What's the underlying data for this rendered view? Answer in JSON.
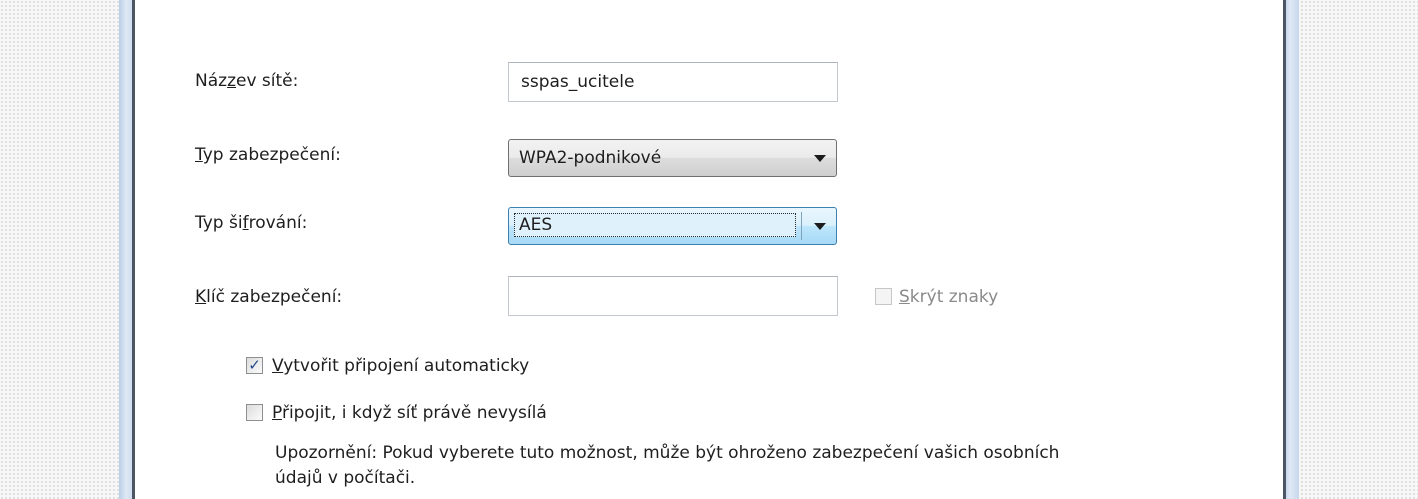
{
  "form": {
    "network_name": {
      "accel": "z",
      "label_before": "Náz",
      "label_after": "ev sítě:",
      "value": "sspas_ucitele"
    },
    "security_type": {
      "accel": "T",
      "label_before": "",
      "label_after": "yp zabezpečení:",
      "selected": "WPA2-podnikové"
    },
    "encryption_type": {
      "accel": "f",
      "label_before": "Typ ši",
      "label_after": "rování:",
      "selected": "AES"
    },
    "security_key": {
      "accel": "K",
      "label_before": "",
      "label_after": "líč zabezpečení:",
      "value": ""
    },
    "hide_characters": {
      "accel": "S",
      "label_before": "",
      "label_after": "krýt znaky",
      "checked": false,
      "enabled": false
    },
    "auto_connect": {
      "accel": "V",
      "label_before": "",
      "label_after": "ytvořit připojení automaticky",
      "checked": true,
      "check_glyph": "✓"
    },
    "connect_hidden": {
      "accel": "P",
      "label_before": "",
      "label_after": "řipojit, i když síť právě nevysílá",
      "checked": false
    },
    "warning_line1": "Upozornění: Pokud vyberete tuto možnost, může být ohroženo zabezpečení vašich osobních",
    "warning_line2": "údajů v počítači."
  },
  "colors": {
    "focus_border": "#3c7fb1",
    "check_mark": "#274a8c",
    "disabled_text": "#8a8a8a"
  }
}
